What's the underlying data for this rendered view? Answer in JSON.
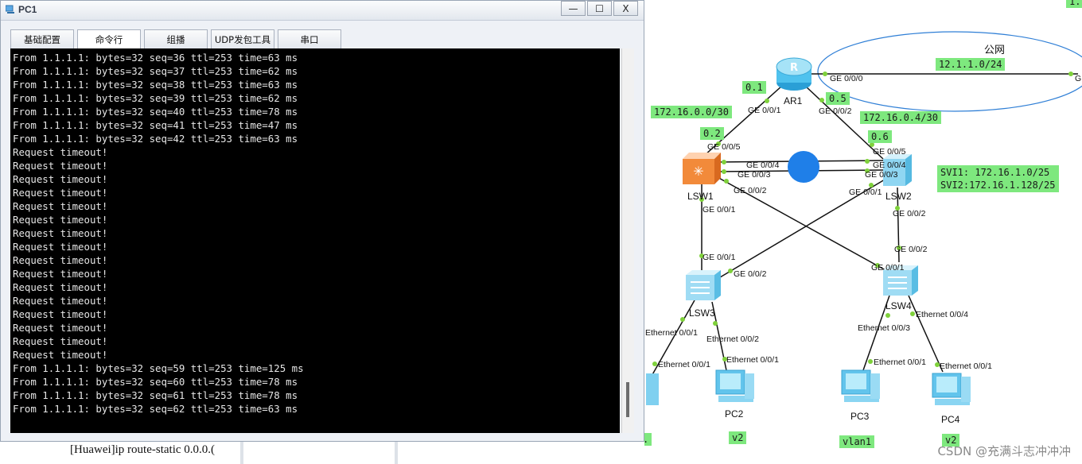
{
  "window": {
    "title": "PC1",
    "minimize_symbol": "—",
    "maximize_symbol": "☐",
    "close_symbol": "X"
  },
  "tabs": [
    {
      "label": "基础配置",
      "active": false
    },
    {
      "label": "命令行",
      "active": true
    },
    {
      "label": "组播",
      "active": false
    },
    {
      "label": "UDP发包工具",
      "active": false
    },
    {
      "label": "串口",
      "active": false
    }
  ],
  "console_lines": [
    "From 1.1.1.1: bytes=32 seq=36 ttl=253 time=63 ms",
    "From 1.1.1.1: bytes=32 seq=37 ttl=253 time=62 ms",
    "From 1.1.1.1: bytes=32 seq=38 ttl=253 time=63 ms",
    "From 1.1.1.1: bytes=32 seq=39 ttl=253 time=62 ms",
    "From 1.1.1.1: bytes=32 seq=40 ttl=253 time=78 ms",
    "From 1.1.1.1: bytes=32 seq=41 ttl=253 time=47 ms",
    "From 1.1.1.1: bytes=32 seq=42 ttl=253 time=63 ms",
    "Request timeout!",
    "Request timeout!",
    "Request timeout!",
    "Request timeout!",
    "Request timeout!",
    "Request timeout!",
    "Request timeout!",
    "Request timeout!",
    "Request timeout!",
    "Request timeout!",
    "Request timeout!",
    "Request timeout!",
    "Request timeout!",
    "Request timeout!",
    "Request timeout!",
    "Request timeout!",
    "From 1.1.1.1: bytes=32 seq=59 ttl=253 time=125 ms",
    "From 1.1.1.1: bytes=32 seq=60 ttl=253 time=78 ms",
    "From 1.1.1.1: bytes=32 seq=61 ttl=253 time=78 ms",
    "From 1.1.1.1: bytes=32 seq=62 ttl=253 time=63 ms"
  ],
  "below_window_text": "[Huawei]ip route-static 0.0.0.(",
  "topology": {
    "cloud_label": "公网",
    "net_labels": {
      "wan": "12.1.1.0/24",
      "ar1_lsw1_net": "172.16.0.0/30",
      "ar1_lsw2_net": "172.16.0.4/30",
      "ar1_lsw1_ar_ip": "0.1",
      "ar1_lsw1_sw_ip": "0.2",
      "ar1_lsw2_ar_ip": "0.5",
      "ar1_lsw2_sw_ip": "0.6",
      "svi1": "SVI1: 172.16.1.0/25",
      "svi2": "SVI2:172.16.1.128/25",
      "pc2_vlan": "v2",
      "pc3_vlan": "vlan1",
      "pc4_vlan": "v2",
      "top_right_fragment": "1.",
      "bottom_left_fragment": "."
    },
    "devices": {
      "ar1": "AR1",
      "lsw1": "LSW1",
      "lsw2": "LSW2",
      "lsw3": "LSW3",
      "lsw4": "LSW4",
      "pc2": "PC2",
      "pc3": "PC3",
      "pc4": "PC4"
    },
    "ports": {
      "ar1_g000": "GE 0/0/0",
      "ar1_g001": "GE 0/0/1",
      "ar1_g002": "GE 0/0/2",
      "far_g": "G",
      "lsw1_g005": "GE 0/0/5",
      "lsw1_g004": "GE 0/0/4",
      "lsw1_g003": "GE 0/0/3",
      "lsw1_g002": "GE 0/0/2",
      "lsw1_g001": "GE 0/0/1",
      "lsw2_g005": "GE 0/0/5",
      "lsw2_g004": "GE 0/0/4",
      "lsw2_g003": "GE 0/0/3",
      "lsw2_g001": "GE 0/0/1",
      "lsw2_g002": "GE 0/0/2",
      "lsw3_g001": "GE 0/0/1",
      "lsw3_g002": "GE 0/0/2",
      "lsw3_e001": "Ethernet 0/0/1",
      "lsw3_e002": "Ethernet 0/0/2",
      "pc1_e001": "Ethernet 0/0/1",
      "pc2_e001": "Ethernet 0/0/1",
      "lsw4_g001": "GE 0/0/1",
      "lsw4_g002": "GE 0/0/2",
      "lsw4_e003": "Ethernet 0/0/3",
      "lsw4_e004": "Ethernet 0/0/4",
      "pc3_e001": "Ethernet 0/0/1",
      "pc4_e001": "Ethernet 0/0/1"
    }
  },
  "watermark": "CSDN @充满斗志冲冲冲",
  "colors": {
    "console_bg": "#000000",
    "console_fg": "#e6e6e6",
    "label_green": "#7ee87e",
    "link_port_dot": "#7fd13b",
    "cloud_stroke": "#2f7fd6",
    "stp_block": "#1f7fe8"
  }
}
